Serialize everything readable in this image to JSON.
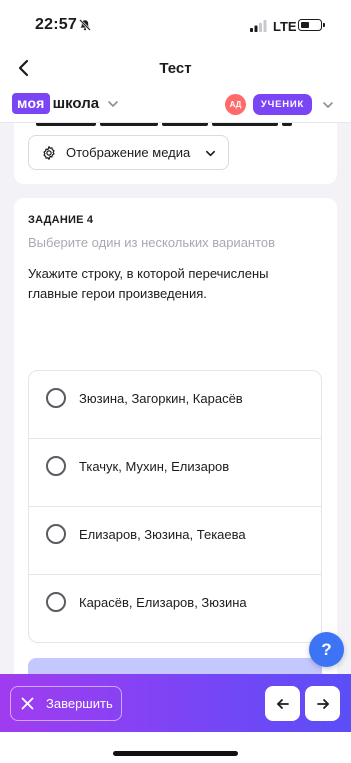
{
  "status_bar": {
    "time": "22:57",
    "network": "LTE"
  },
  "nav": {
    "title": "Тест"
  },
  "header": {
    "logo_part1": "моя",
    "logo_part2": "школа",
    "avatar_initials": "АД",
    "role": "УЧЕНИК"
  },
  "media_button": {
    "label": "Отображение медиа"
  },
  "task": {
    "number": "ЗАДАНИЕ 4",
    "hint": "Выберите один из нескольких вариантов",
    "question": "Укажите строку, в которой перечислены главные герои произведения.",
    "options": [
      "Зюзина, Загоркин, Карасёв",
      "Ткачук, Мухин, Елизаров",
      "Елизаров, Зюзина, Текаева",
      "Карасёв, Елизаров, Зюзина"
    ]
  },
  "help_button": {
    "label": "?"
  },
  "bottom_bar": {
    "finish_label": "Завершить"
  },
  "icons": {
    "back": "chevron-left-icon",
    "bell": "bell-slash-icon",
    "gear": "gear-icon",
    "help": "question-icon",
    "finish": "close-icon",
    "prev": "arrow-left-icon",
    "next": "arrow-right-icon"
  },
  "colors": {
    "accent": "#7a45f5",
    "help": "#3d73f5",
    "avatar": "#ff6b6b",
    "submit_disabled": "#c3c8ff"
  }
}
